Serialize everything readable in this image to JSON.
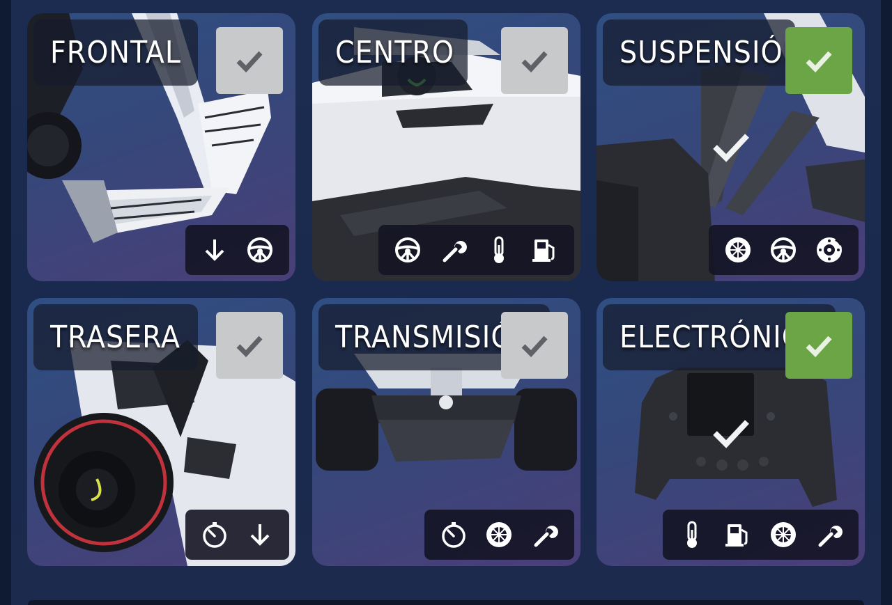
{
  "colors": {
    "check_done": "#6ba545",
    "check_pending": "#c7c9cb",
    "icon_bar": "#16152a",
    "background": "#1c2b50"
  },
  "cards": [
    {
      "id": "frontal",
      "title": "FRONTAL",
      "completed": false,
      "icons": [
        "arrow-down-icon",
        "steering-wheel-icon"
      ]
    },
    {
      "id": "centro",
      "title": "CENTRO",
      "completed": false,
      "icons": [
        "steering-wheel-icon",
        "wrench-icon",
        "thermometer-icon",
        "fuel-pump-icon"
      ]
    },
    {
      "id": "suspension",
      "title": "SUSPENSIÓN",
      "completed": true,
      "icons": [
        "tyre-icon",
        "steering-wheel-icon",
        "brake-disc-icon"
      ]
    },
    {
      "id": "trasera",
      "title": "TRASERA",
      "completed": false,
      "icons": [
        "stopwatch-icon",
        "arrow-down-icon"
      ]
    },
    {
      "id": "transmision",
      "title": "TRANSMISIÓN",
      "completed": false,
      "icons": [
        "stopwatch-icon",
        "tyre-icon",
        "wrench-icon"
      ]
    },
    {
      "id": "electronica",
      "title": "ELECTRÓNICA",
      "completed": true,
      "icons": [
        "thermometer-icon",
        "fuel-pump-icon",
        "tyre-icon",
        "wrench-icon"
      ]
    }
  ]
}
